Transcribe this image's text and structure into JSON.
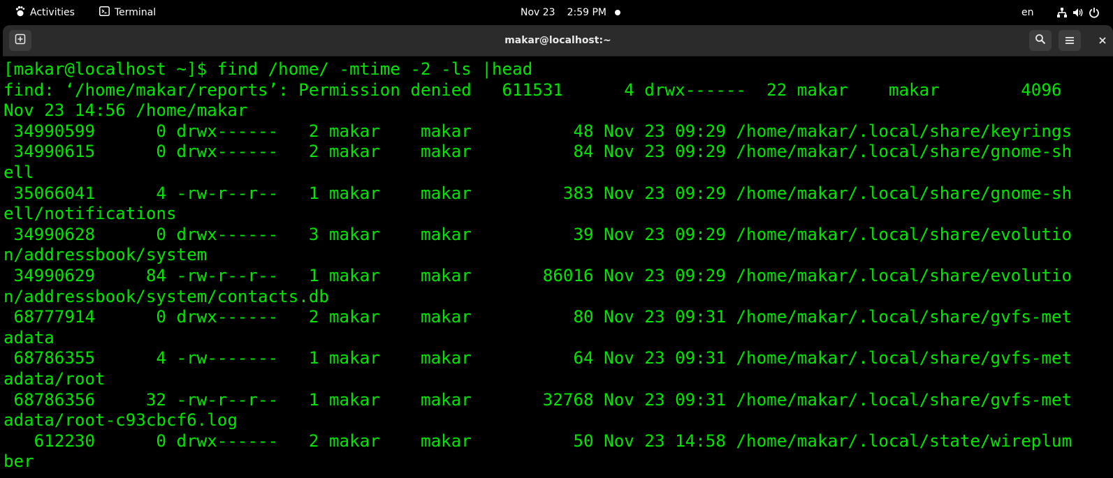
{
  "topbar": {
    "activities_label": "Activities",
    "app_name": "Terminal",
    "date": "Nov 23",
    "time": "2:59 PM",
    "keyboard_layout": "en"
  },
  "window": {
    "title": "makar@localhost:~"
  },
  "colors": {
    "terminal_text": "#00e500",
    "terminal_bg": "#000000",
    "headerbar_bg": "#2b2b2b"
  },
  "icons": {
    "activities": "gnome-foot-icon",
    "app": "terminal-icon",
    "new_tab": "new-tab-icon",
    "search": "search-icon",
    "menu": "hamburger-menu-icon",
    "close": "close-icon",
    "network": "network-icon",
    "volume": "volume-icon",
    "power": "power-icon"
  },
  "terminal": {
    "lines": [
      "[makar@localhost ~]$ find /home/ -mtime -2 -ls |head",
      "find: ‘/home/makar/reports’: Permission denied   611531      4 drwx------  22 makar    makar        4096 ",
      "Nov 23 14:56 /home/makar",
      " 34990599      0 drwx------   2 makar    makar          48 Nov 23 09:29 /home/makar/.local/share/keyrings",
      " 34990615      0 drwx------   2 makar    makar          84 Nov 23 09:29 /home/makar/.local/share/gnome-sh",
      "ell",
      " 35066041      4 -rw-r--r--   1 makar    makar         383 Nov 23 09:29 /home/makar/.local/share/gnome-sh",
      "ell/notifications",
      " 34990628      0 drwx------   3 makar    makar          39 Nov 23 09:29 /home/makar/.local/share/evolutio",
      "n/addressbook/system",
      " 34990629     84 -rw-r--r--   1 makar    makar       86016 Nov 23 09:29 /home/makar/.local/share/evolutio",
      "n/addressbook/system/contacts.db",
      " 68777914      0 drwx------   2 makar    makar          80 Nov 23 09:31 /home/makar/.local/share/gvfs-met",
      "adata",
      " 68786355      4 -rw-------   1 makar    makar          64 Nov 23 09:31 /home/makar/.local/share/gvfs-met",
      "adata/root",
      " 68786356     32 -rw-r--r--   1 makar    makar       32768 Nov 23 09:31 /home/makar/.local/share/gvfs-met",
      "adata/root-c93cbcf6.log",
      "   612230      0 drwx------   2 makar    makar          50 Nov 23 14:58 /home/makar/.local/state/wireplum",
      "ber"
    ]
  }
}
